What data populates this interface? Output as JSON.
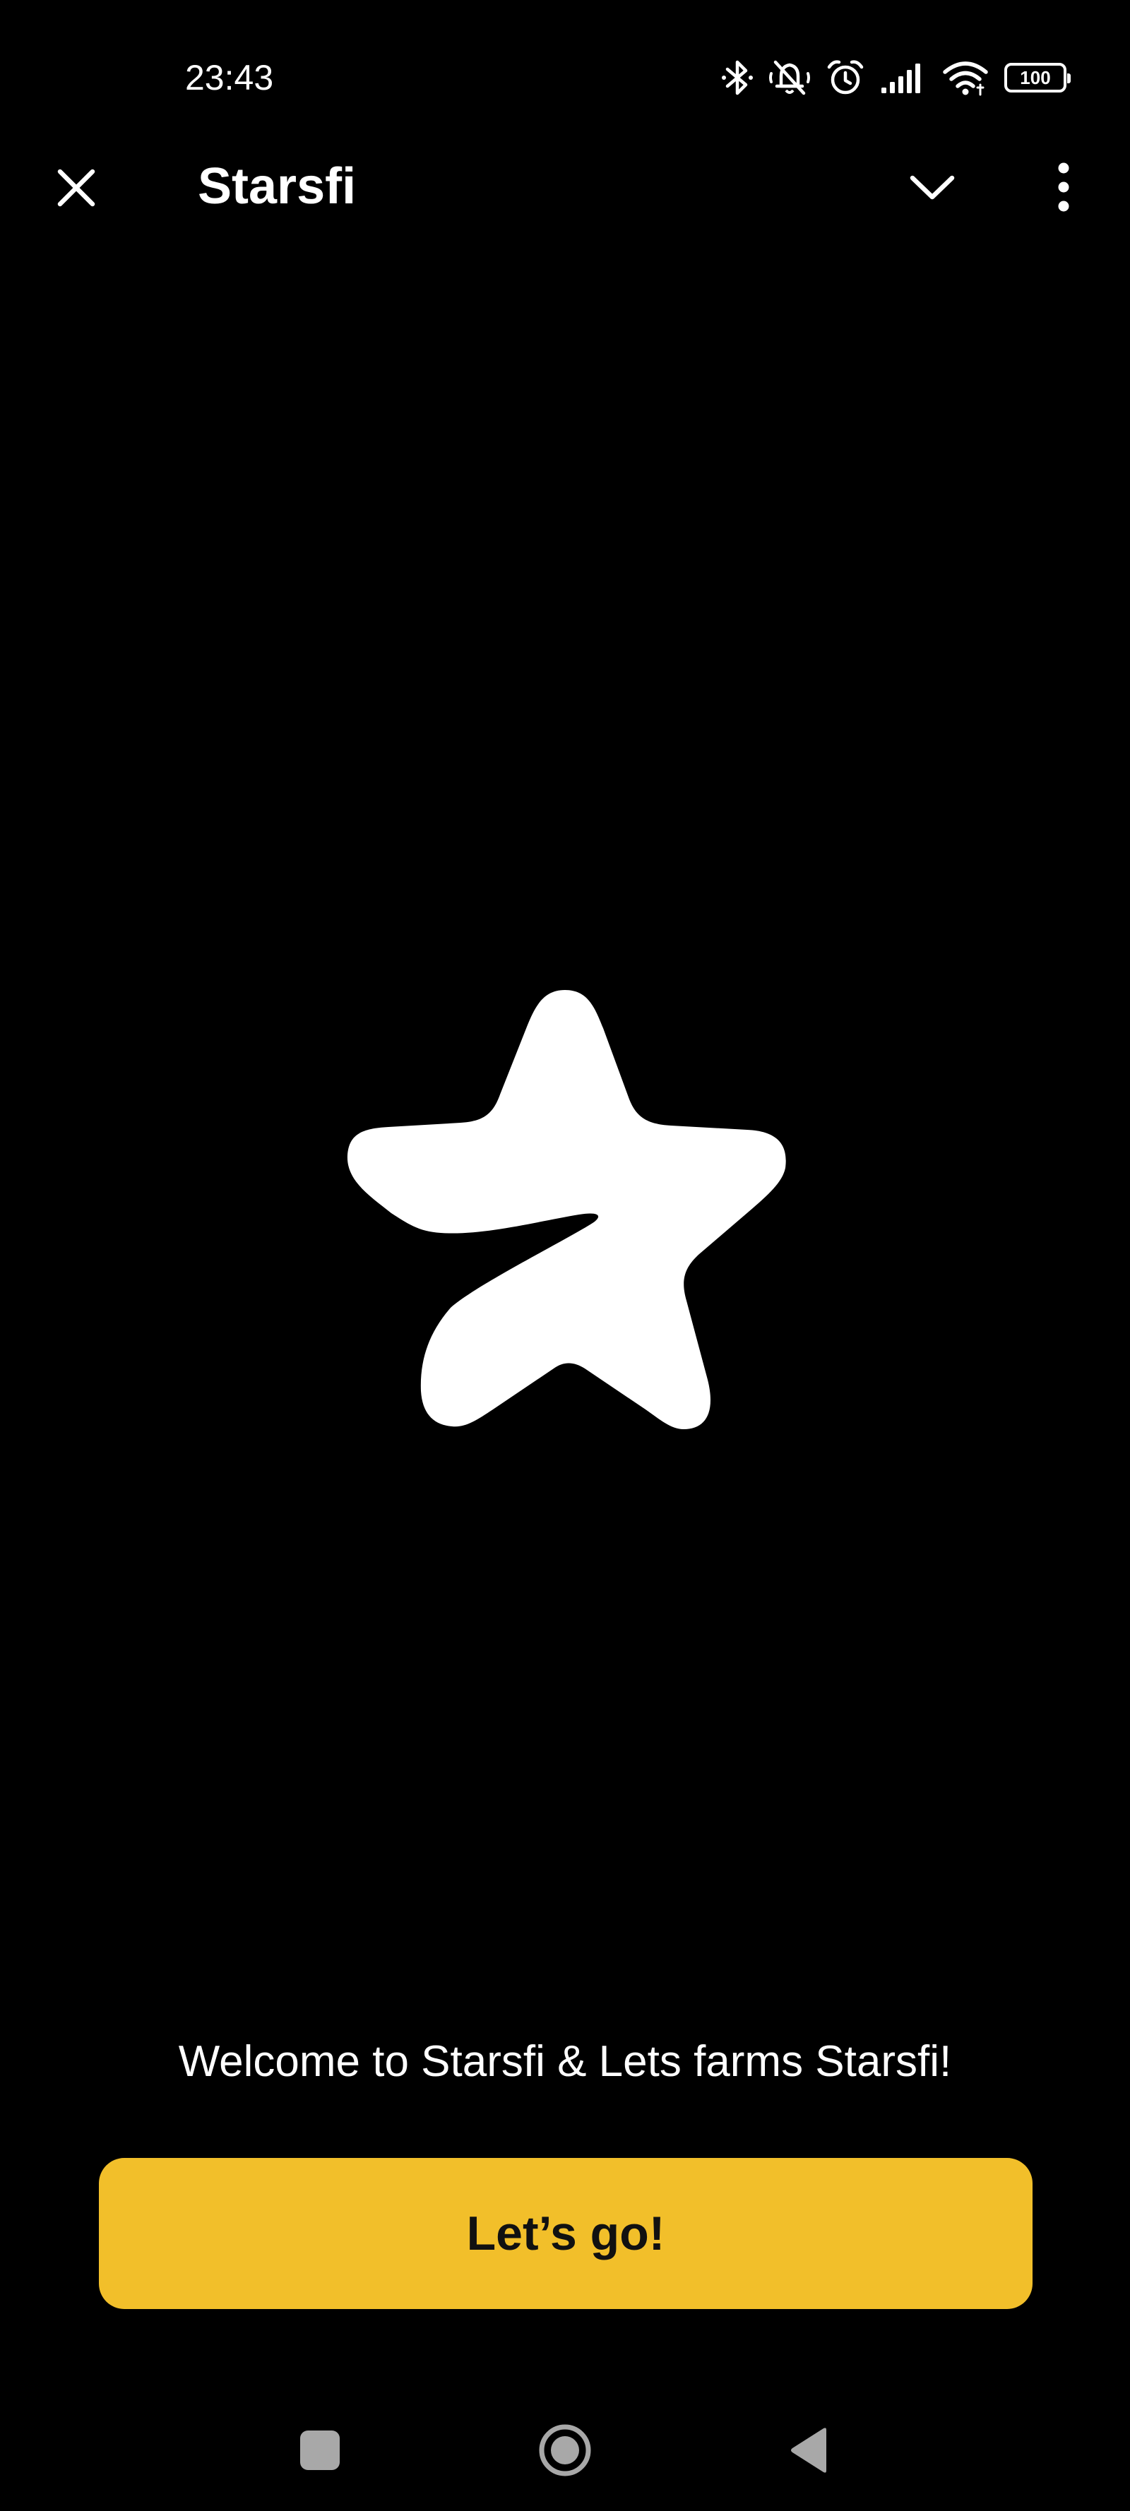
{
  "status_bar": {
    "time": "23:43",
    "battery_level": "100",
    "icons": [
      "bluetooth-icon",
      "mute-icon",
      "alarm-icon",
      "signal-icon",
      "wifi-icon",
      "battery-icon"
    ]
  },
  "header": {
    "title": "Starsfi",
    "close_icon": "close-icon",
    "chevron_icon": "chevron-down-icon",
    "more_icon": "more-vertical-icon"
  },
  "logo": {
    "icon": "star-logo-icon",
    "color": "#ffffff"
  },
  "welcome": {
    "text": "Welcome to Starsfi & Lets farms Starsfi!"
  },
  "cta": {
    "label": "Let’s go!",
    "color": "#f2bf2a"
  },
  "nav_bar": {
    "icons": [
      "recents-icon",
      "home-icon",
      "back-icon"
    ]
  },
  "theme": {
    "background": "#000000",
    "text": "#ffffff"
  }
}
